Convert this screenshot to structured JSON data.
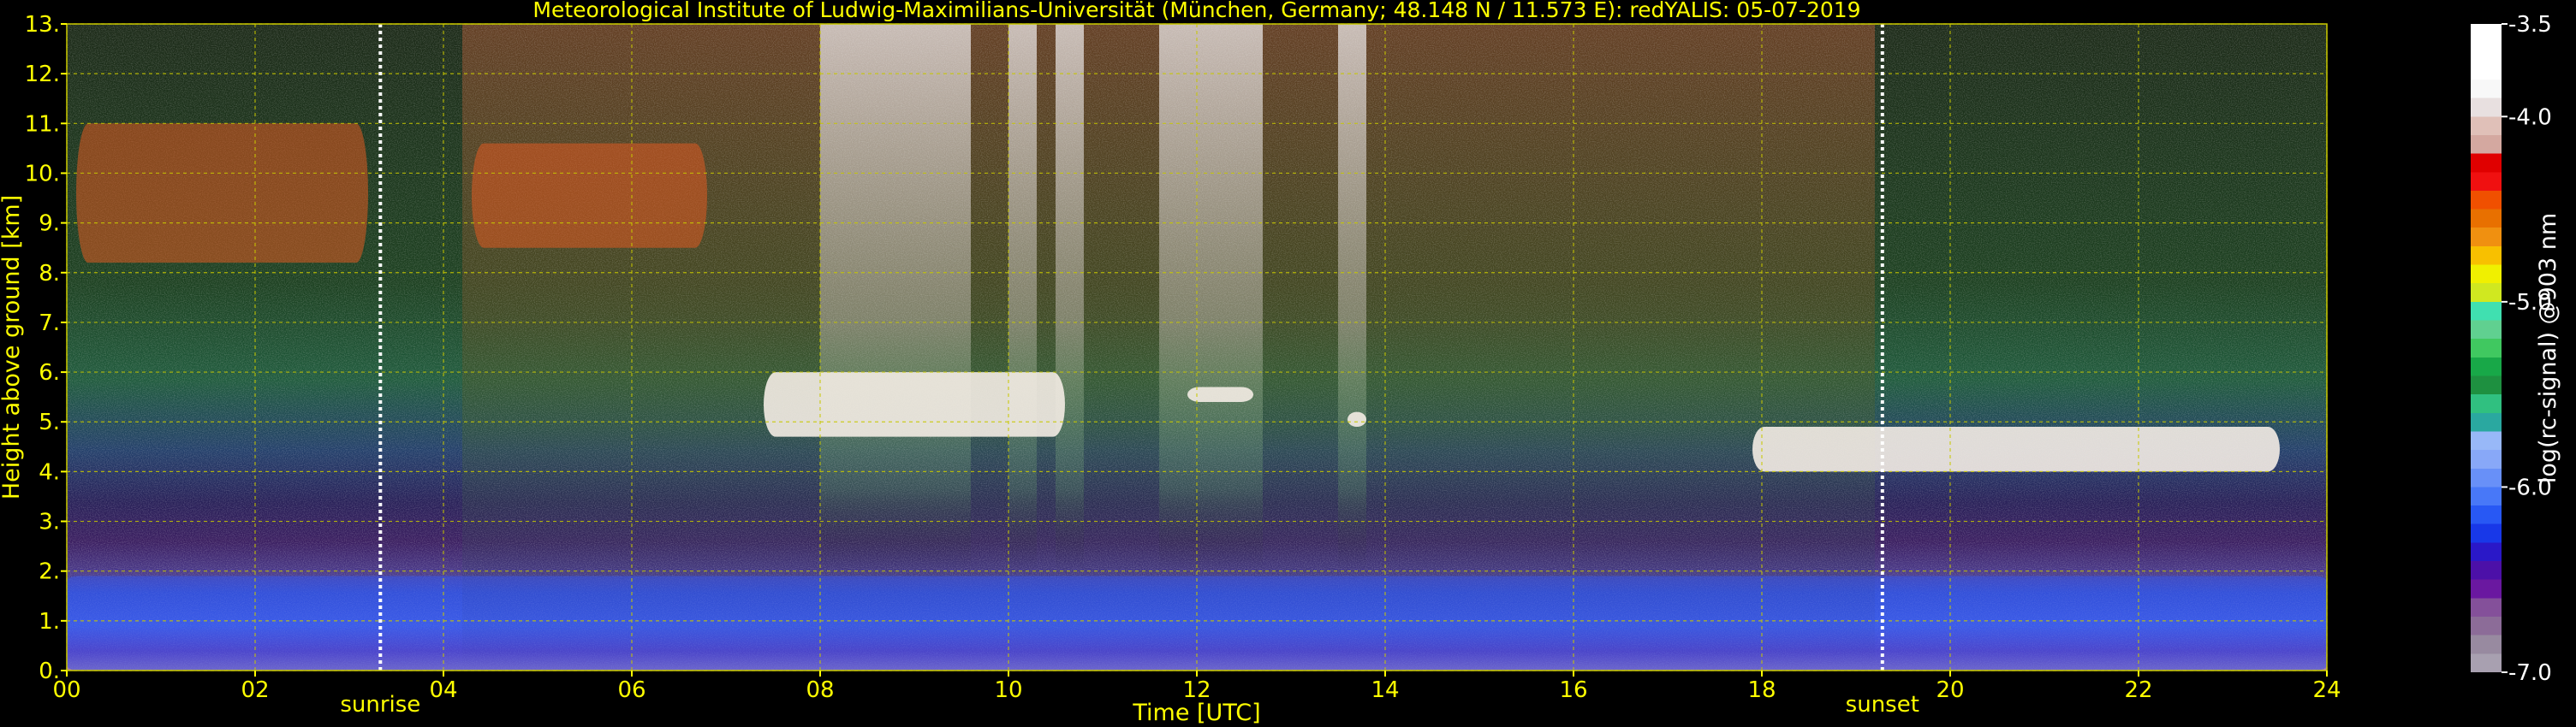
{
  "chart_data": {
    "type": "heatmap",
    "title": "Meteorological Institute of Ludwig-Maximilians-Universität (München, Germany; 48.148 N / 11.573 E):    redYALIS: 05-07-2019",
    "xlabel": "Time [UTC]",
    "ylabel": "Height above ground [km]",
    "xlim": [
      0,
      24
    ],
    "ylim": [
      0,
      13
    ],
    "grid": true,
    "x_ticks": [
      {
        "value": 0,
        "label": "00"
      },
      {
        "value": 2,
        "label": "02"
      },
      {
        "value": 4,
        "label": "04"
      },
      {
        "value": 6,
        "label": "06"
      },
      {
        "value": 8,
        "label": "08"
      },
      {
        "value": 10,
        "label": "10"
      },
      {
        "value": 12,
        "label": "12"
      },
      {
        "value": 14,
        "label": "14"
      },
      {
        "value": 16,
        "label": "16"
      },
      {
        "value": 18,
        "label": "18"
      },
      {
        "value": 20,
        "label": "20"
      },
      {
        "value": 22,
        "label": "22"
      },
      {
        "value": 24,
        "label": "24"
      }
    ],
    "y_ticks": [
      {
        "value": 0,
        "label": "0."
      },
      {
        "value": 1,
        "label": "1."
      },
      {
        "value": 2,
        "label": "2."
      },
      {
        "value": 3,
        "label": "3."
      },
      {
        "value": 4,
        "label": "4."
      },
      {
        "value": 5,
        "label": "5."
      },
      {
        "value": 6,
        "label": "6."
      },
      {
        "value": 7,
        "label": "7."
      },
      {
        "value": 8,
        "label": "8."
      },
      {
        "value": 9,
        "label": "9."
      },
      {
        "value": 10,
        "label": "10."
      },
      {
        "value": 11,
        "label": "11."
      },
      {
        "value": 12,
        "label": "12."
      },
      {
        "value": 13,
        "label": "13."
      }
    ],
    "annotations": [
      {
        "text": "sunrise",
        "x": 3.33
      },
      {
        "text": "sunset",
        "x": 19.28
      }
    ],
    "colorbar": {
      "label": "log(rc-signal) @903 nm",
      "range": [
        -7.0,
        -3.5
      ],
      "ticks": [
        {
          "value": -3.5,
          "label": "-3.5"
        },
        {
          "value": -4.0,
          "label": "-4.0"
        },
        {
          "value": -5.0,
          "label": "-5.0"
        },
        {
          "value": -6.0,
          "label": "-6.0"
        },
        {
          "value": -7.0,
          "label": "-7.0"
        }
      ],
      "colors": [
        "#a8a0b0",
        "#988aa0",
        "#8c6c98",
        "#84509a",
        "#6a18a0",
        "#4c10a8",
        "#2a18c8",
        "#1838e8",
        "#2858f4",
        "#4878f8",
        "#6890f8",
        "#88a8f8",
        "#98b8f8",
        "#2aa8a0",
        "#30c080",
        "#1e9040",
        "#18a848",
        "#40c860",
        "#60d090",
        "#40e0b0",
        "#d0e820",
        "#f0f000",
        "#f8c000",
        "#f09010",
        "#e87000",
        "#f05000",
        "#f01010",
        "#e00000",
        "#d4a8a0",
        "#e0c0b8",
        "#e8e0e0",
        "#f8f8f8",
        "#ffffff",
        "#ffffff",
        "#ffffff"
      ]
    },
    "features": [
      {
        "name": "cirrus",
        "t_start": 0.1,
        "t_end": 3.2,
        "z_bottom": 8.2,
        "z_top": 11.0
      },
      {
        "name": "cirrus",
        "t_start": 4.3,
        "t_end": 6.8,
        "z_bottom": 8.5,
        "z_top": 10.6
      },
      {
        "name": "cloud layer",
        "t_start": 7.4,
        "t_end": 10.6,
        "z_bottom": 4.7,
        "z_top": 6.0
      },
      {
        "name": "cloud layer",
        "t_start": 11.9,
        "t_end": 12.6,
        "z_bottom": 5.4,
        "z_top": 5.7
      },
      {
        "name": "cloud layer",
        "t_start": 13.6,
        "t_end": 13.8,
        "z_bottom": 4.9,
        "z_top": 5.2
      },
      {
        "name": "cloud layer",
        "t_start": 17.9,
        "t_end": 23.5,
        "z_bottom": 4.0,
        "z_top": 4.9
      },
      {
        "name": "boundary layer",
        "t_start": 0,
        "t_end": 24,
        "z_bottom": 0,
        "z_top": 1.9
      }
    ],
    "colors": {
      "text": "#ffff00",
      "grid": "#c8c800",
      "annotation": "#ffffff",
      "background": "#000000"
    }
  }
}
